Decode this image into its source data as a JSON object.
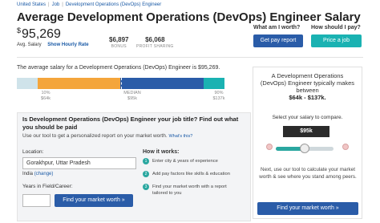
{
  "breadcrumb": [
    "United States",
    "Job",
    "Development Operations (DevOps) Engineer"
  ],
  "page_title": "Average Development Operations (DevOps) Engineer Salary",
  "salary": {
    "currency": "$",
    "amount": "95,269",
    "avg_label": "Avg. Salary",
    "hourly_link": "Show Hourly Rate"
  },
  "bonus": {
    "value": "$6,897",
    "label": "BONUS"
  },
  "profit_sharing": {
    "value": "$6,068",
    "label": "PROFIT SHARING"
  },
  "cta": {
    "worth_q": "What am I worth?",
    "worth_btn": "Get pay report",
    "pay_q": "How should I pay?",
    "pay_btn": "Price a job"
  },
  "distribution": {
    "lead_text": "The average salary for a Development Operations (DevOps) Engineer is $95,269.",
    "percentile_10": 0.1,
    "median_marker": 0.5,
    "percentile_90": 0.9,
    "colors": {
      "pale": "#cfe3ea",
      "orange": "#f4a53b",
      "blue": "#2a5ca8",
      "teal": "#1ab2b2"
    },
    "ticks": [
      {
        "top": "10%",
        "bottom": "$64k"
      },
      {
        "top": "MEDIAN",
        "bottom": "$95k"
      },
      {
        "top": "90%",
        "bottom": "$137k"
      }
    ]
  },
  "report_form": {
    "title": "Is Development Operations (DevOps) Engineer your job title? Find out what you should be paid",
    "subtitle": "Use our tool to get a personalized report on your market worth.",
    "whats_this": "What's this?",
    "location_label": "Location:",
    "location_value": "Gorakhpur, Uttar Pradesh",
    "country": "India",
    "change_link": "(change)",
    "years_label": "Years in Field/Career:",
    "years_value": "",
    "button": "Find your market worth »",
    "how_title": "How it works:",
    "steps": [
      {
        "num": "1",
        "text": "Enter city & years of experience"
      },
      {
        "num": "2",
        "text": "Add pay factors like skills & education"
      },
      {
        "num": "3",
        "text": "Find your market worth with a report tailored to you"
      }
    ]
  },
  "sidebar": {
    "header_line": "A Development Operations (DevOps) Engineer typically makes between",
    "range": "$64k - $137k.",
    "compare_text": "Select your salary to compare.",
    "selected": "$95k",
    "slider_level": 0.5,
    "next_text": "Next, use our tool to calculate your market worth & see where you stand among peers.",
    "button": "Find your market worth »"
  }
}
